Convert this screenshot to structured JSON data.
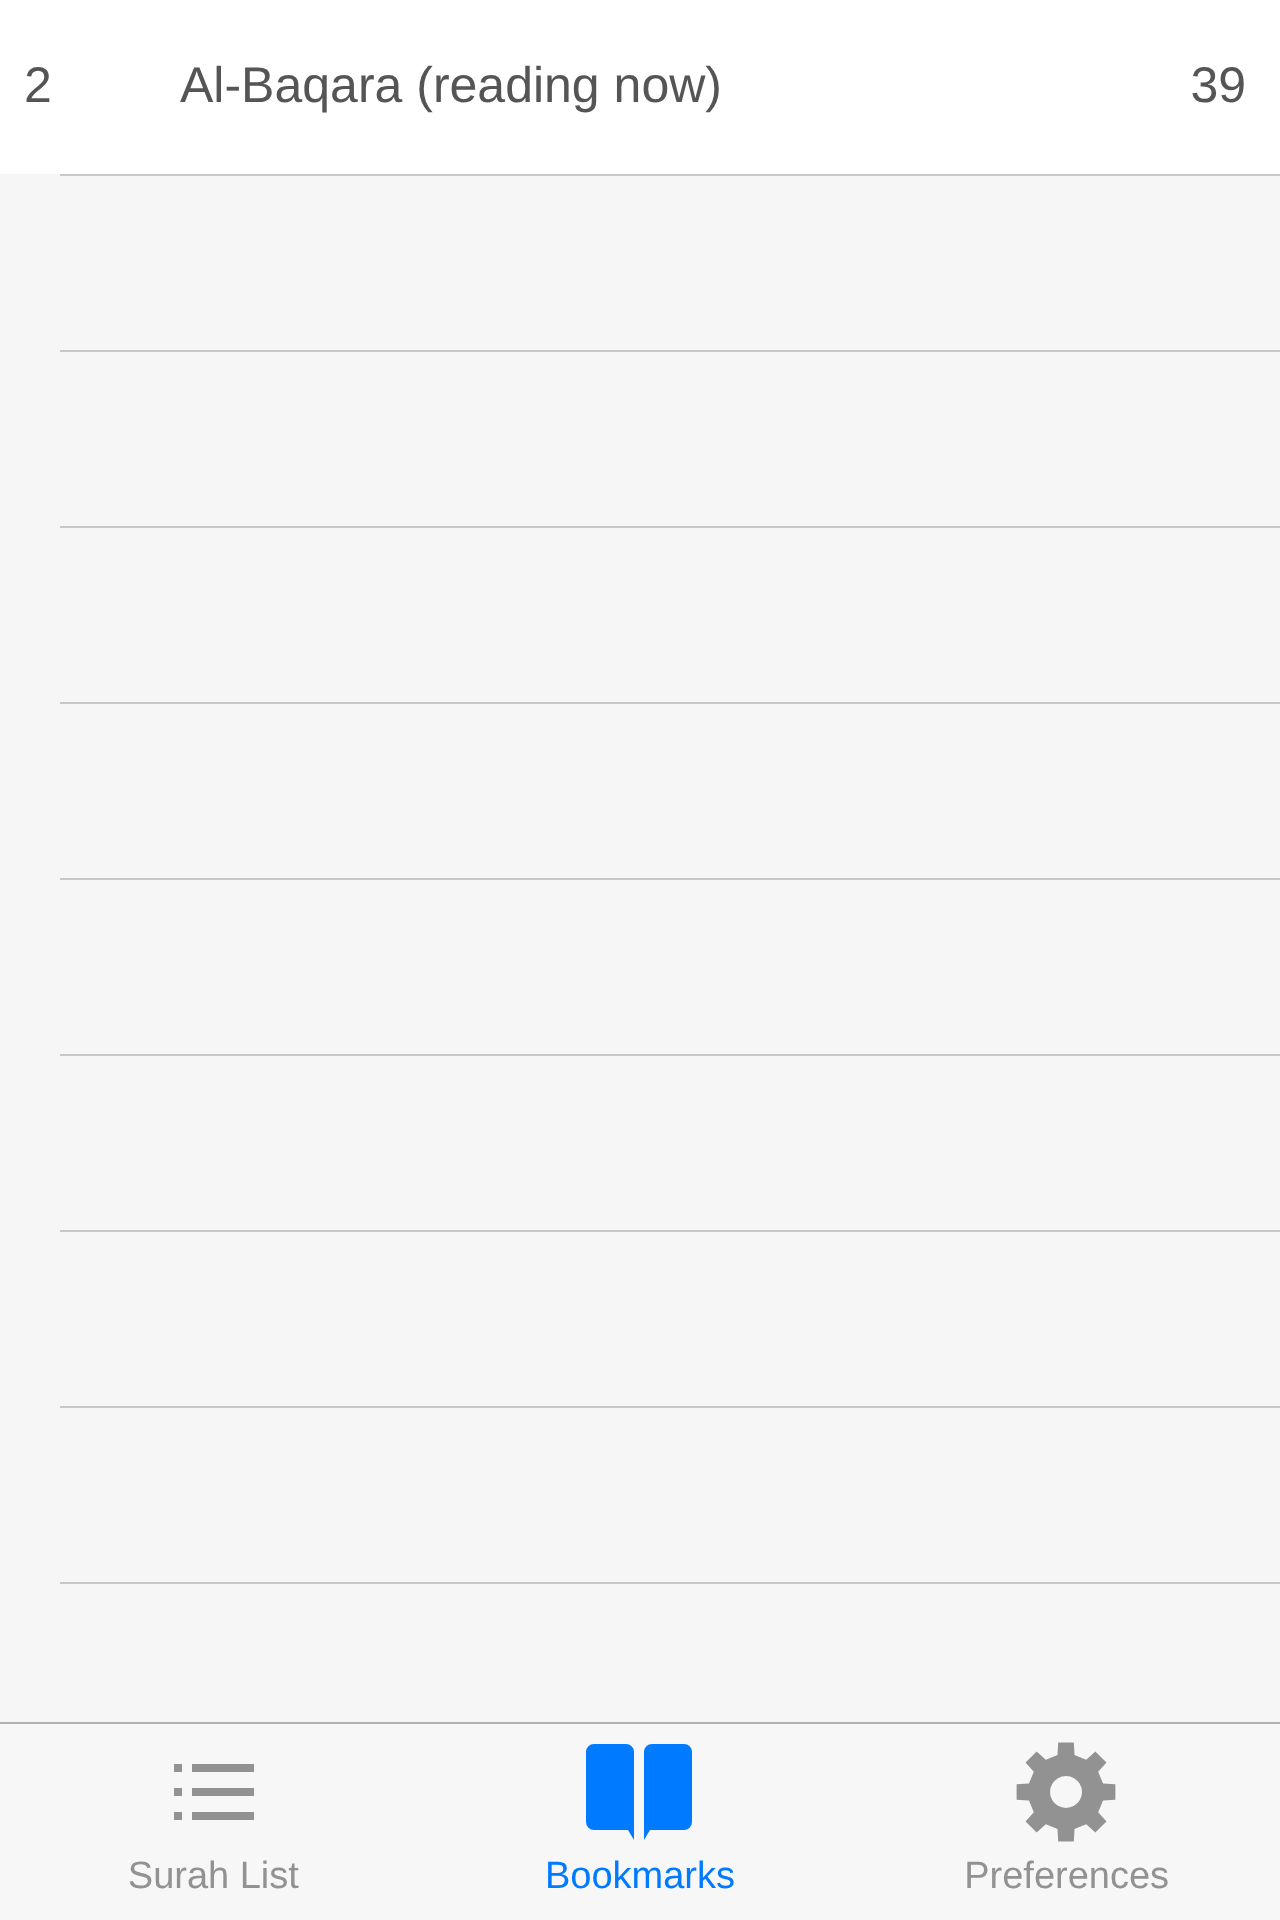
{
  "bookmarks": [
    {
      "number": "2",
      "title": "Al-Baqara (reading now)",
      "count": "39"
    }
  ],
  "tab_bar": {
    "tabs": [
      {
        "label": "Surah List",
        "selected": false
      },
      {
        "label": "Bookmarks",
        "selected": true
      },
      {
        "label": "Preferences",
        "selected": false
      }
    ]
  }
}
